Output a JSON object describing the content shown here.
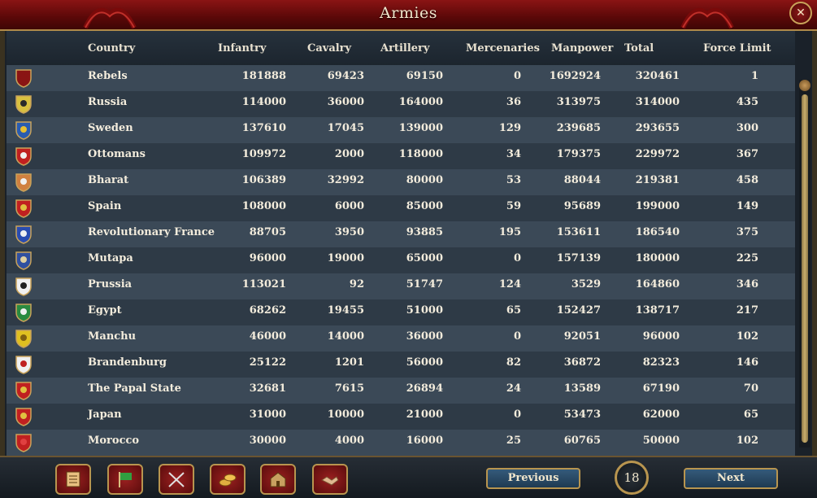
{
  "window": {
    "title": "Armies",
    "close_label": "✕"
  },
  "columns": [
    "Country",
    "Infantry",
    "Cavalry",
    "Artillery",
    "Mercenaries",
    "Manpower",
    "Total",
    "Force Limit"
  ],
  "rows": [
    {
      "country": "Rebels",
      "infantry": "181888",
      "cavalry": "69423",
      "artillery": "69150",
      "mercenaries": "0",
      "manpower": "1692924",
      "total": "320461",
      "force_limit": "1",
      "colors": [
        "#8a1414",
        "#8a1414"
      ]
    },
    {
      "country": "Russia",
      "infantry": "114000",
      "cavalry": "36000",
      "artillery": "164000",
      "mercenaries": "36",
      "manpower": "313975",
      "total": "314000",
      "force_limit": "435",
      "colors": [
        "#d8c040",
        "#2a2a2a"
      ]
    },
    {
      "country": "Sweden",
      "infantry": "137610",
      "cavalry": "17045",
      "artillery": "139000",
      "mercenaries": "129",
      "manpower": "239685",
      "total": "293655",
      "force_limit": "300",
      "colors": [
        "#2a5cb0",
        "#e8c030"
      ]
    },
    {
      "country": "Ottomans",
      "infantry": "109972",
      "cavalry": "2000",
      "artillery": "118000",
      "mercenaries": "34",
      "manpower": "179375",
      "total": "229972",
      "force_limit": "367",
      "colors": [
        "#c02020",
        "#f0f0f0"
      ]
    },
    {
      "country": "Bharat",
      "infantry": "106389",
      "cavalry": "32992",
      "artillery": "80000",
      "mercenaries": "53",
      "manpower": "88044",
      "total": "219381",
      "force_limit": "458",
      "colors": [
        "#d08040",
        "#f0f0f0"
      ]
    },
    {
      "country": "Spain",
      "infantry": "108000",
      "cavalry": "6000",
      "artillery": "85000",
      "mercenaries": "59",
      "manpower": "95689",
      "total": "199000",
      "force_limit": "149",
      "colors": [
        "#c02020",
        "#e0c040"
      ]
    },
    {
      "country": "Revolutionary France",
      "infantry": "88705",
      "cavalry": "3950",
      "artillery": "93885",
      "mercenaries": "195",
      "manpower": "153611",
      "total": "186540",
      "force_limit": "375",
      "colors": [
        "#2a4cb0",
        "#f0f0f0"
      ]
    },
    {
      "country": "Mutapa",
      "infantry": "96000",
      "cavalry": "19000",
      "artillery": "65000",
      "mercenaries": "0",
      "manpower": "157139",
      "total": "180000",
      "force_limit": "225",
      "colors": [
        "#3050a0",
        "#e0d0a0"
      ]
    },
    {
      "country": "Prussia",
      "infantry": "113021",
      "cavalry": "92",
      "artillery": "51747",
      "mercenaries": "124",
      "manpower": "3529",
      "total": "164860",
      "force_limit": "346",
      "colors": [
        "#f0f0f0",
        "#202020"
      ]
    },
    {
      "country": "Egypt",
      "infantry": "68262",
      "cavalry": "19455",
      "artillery": "51000",
      "mercenaries": "65",
      "manpower": "152427",
      "total": "138717",
      "force_limit": "217",
      "colors": [
        "#2a8a40",
        "#f0f0f0"
      ]
    },
    {
      "country": "Manchu",
      "infantry": "46000",
      "cavalry": "14000",
      "artillery": "36000",
      "mercenaries": "0",
      "manpower": "92051",
      "total": "96000",
      "force_limit": "102",
      "colors": [
        "#e0c020",
        "#806010"
      ]
    },
    {
      "country": "Brandenburg",
      "infantry": "25122",
      "cavalry": "1201",
      "artillery": "56000",
      "mercenaries": "82",
      "manpower": "36872",
      "total": "82323",
      "force_limit": "146",
      "colors": [
        "#f0f0f0",
        "#c02020"
      ]
    },
    {
      "country": "The Papal State",
      "infantry": "32681",
      "cavalry": "7615",
      "artillery": "26894",
      "mercenaries": "24",
      "manpower": "13589",
      "total": "67190",
      "force_limit": "70",
      "colors": [
        "#c02020",
        "#e0c040"
      ]
    },
    {
      "country": "Japan",
      "infantry": "31000",
      "cavalry": "10000",
      "artillery": "21000",
      "mercenaries": "0",
      "manpower": "53473",
      "total": "62000",
      "force_limit": "65",
      "colors": [
        "#c02020",
        "#e0c040"
      ]
    },
    {
      "country": "Morocco",
      "infantry": "30000",
      "cavalry": "4000",
      "artillery": "16000",
      "mercenaries": "25",
      "manpower": "60765",
      "total": "50000",
      "force_limit": "102",
      "colors": [
        "#c02020",
        "#e04040"
      ]
    }
  ],
  "footer": {
    "buttons": [
      "ledger-icon",
      "flag-icon",
      "crossed-swords-icon",
      "coins-icon",
      "buildings-icon",
      "handshake-icon"
    ],
    "previous_label": "Previous",
    "next_label": "Next",
    "page_number": "18"
  }
}
